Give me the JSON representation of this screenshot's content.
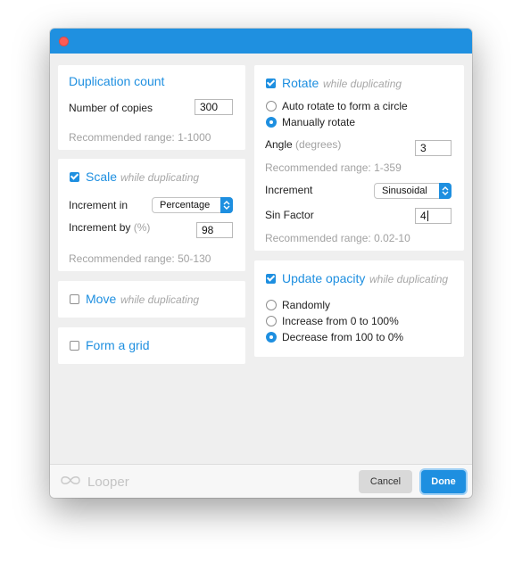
{
  "window": {
    "close_icon": "close-traffic-light"
  },
  "duplication": {
    "title": "Duplication count",
    "copies_label": "Number of copies",
    "copies_value": "300",
    "range": "Recommended range: 1-1000"
  },
  "scale": {
    "title": "Scale",
    "hint": "while duplicating",
    "checked": true,
    "increment_in_label": "Increment in",
    "increment_in_value": "Percentage",
    "increment_by_label": "Increment by",
    "increment_by_unit": "(%)",
    "increment_by_value": "98",
    "range": "Recommended range: 50-130"
  },
  "move": {
    "title": "Move",
    "hint": "while duplicating",
    "checked": false
  },
  "grid": {
    "title": "Form a grid",
    "checked": false
  },
  "rotate": {
    "title": "Rotate",
    "hint": "while duplicating",
    "checked": true,
    "options": [
      "Auto rotate to form a circle",
      "Manually rotate"
    ],
    "selected": "Manually rotate",
    "angle_label": "Angle",
    "angle_unit": "(degrees)",
    "angle_value": "3",
    "angle_range": "Recommended range: 1-359",
    "increment_label": "Increment",
    "increment_value": "Sinusoidal",
    "sin_label": "Sin Factor",
    "sin_value": "4",
    "sin_range": "Recommended range: 0.02-10"
  },
  "opacity": {
    "title": "Update opacity",
    "hint": "while duplicating",
    "checked": true,
    "options": [
      "Randomly",
      "Increase from 0 to 100%",
      "Decrease from 100 to 0%"
    ],
    "selected": "Decrease from 100 to 0%"
  },
  "footer": {
    "brand": "Looper",
    "brand_icon": "infinity-icon",
    "cancel": "Cancel",
    "done": "Done"
  },
  "colors": {
    "accent": "#1e8fe0",
    "titlebar": "#1f90e0",
    "close": "#fc5b57"
  }
}
